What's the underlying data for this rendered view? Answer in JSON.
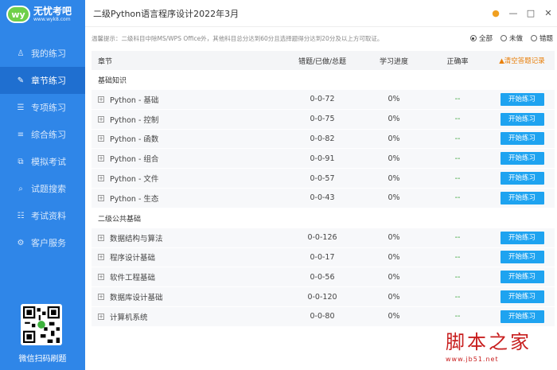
{
  "sidebar": {
    "logo_badge": "wy",
    "logo_name": "无忧考吧",
    "logo_url": "www.wyk8.com",
    "items": [
      {
        "label": "我的练习",
        "icon": "person-icon"
      },
      {
        "label": "章节练习",
        "icon": "pencil-icon",
        "active": true
      },
      {
        "label": "专项练习",
        "icon": "document-icon"
      },
      {
        "label": "综合练习",
        "icon": "list-icon"
      },
      {
        "label": "模拟考试",
        "icon": "copy-icon"
      },
      {
        "label": "试题搜索",
        "icon": "search-icon"
      },
      {
        "label": "考试资料",
        "icon": "book-icon"
      },
      {
        "label": "客户服务",
        "icon": "gear-icon"
      }
    ],
    "qr_label": "微信扫码刷题"
  },
  "titlebar": {
    "title": "二级Python语言程序设计2022年3月"
  },
  "tipbar": {
    "tip": "温馨提示：二级科目中除MS/WPS Office外，其他科目总分达到60分且选择题得分达到20分及以上方可取证。",
    "filters": [
      {
        "label": "全部",
        "selected": true
      },
      {
        "label": "未做",
        "selected": false
      },
      {
        "label": "错题",
        "selected": false
      }
    ]
  },
  "table": {
    "headers": {
      "chapter": "章节",
      "counts": "错题/已做/总题",
      "progress": "学习进度",
      "accuracy": "正确率",
      "clear": "清空答题记录"
    },
    "button_label": "开始练习",
    "groups": [
      {
        "name": "基础知识",
        "rows": [
          {
            "name": "Python - 基础",
            "counts": "0-0-72",
            "progress": "0%",
            "rate": "--"
          },
          {
            "name": "Python - 控制",
            "counts": "0-0-75",
            "progress": "0%",
            "rate": "--"
          },
          {
            "name": "Python - 函数",
            "counts": "0-0-82",
            "progress": "0%",
            "rate": "--"
          },
          {
            "name": "Python - 组合",
            "counts": "0-0-91",
            "progress": "0%",
            "rate": "--"
          },
          {
            "name": "Python - 文件",
            "counts": "0-0-57",
            "progress": "0%",
            "rate": "--"
          },
          {
            "name": "Python - 生态",
            "counts": "0-0-43",
            "progress": "0%",
            "rate": "--"
          }
        ]
      },
      {
        "name": "二级公共基础",
        "rows": [
          {
            "name": "数据结构与算法",
            "counts": "0-0-126",
            "progress": "0%",
            "rate": "--"
          },
          {
            "name": "程序设计基础",
            "counts": "0-0-17",
            "progress": "0%",
            "rate": "--"
          },
          {
            "name": "软件工程基础",
            "counts": "0-0-56",
            "progress": "0%",
            "rate": "--"
          },
          {
            "name": "数据库设计基础",
            "counts": "0-0-120",
            "progress": "0%",
            "rate": "--"
          },
          {
            "name": "计算机系统",
            "counts": "0-0-80",
            "progress": "0%",
            "rate": "--"
          }
        ]
      }
    ]
  },
  "watermark": {
    "main": "脚本之家",
    "url": "www.jb51.net"
  }
}
